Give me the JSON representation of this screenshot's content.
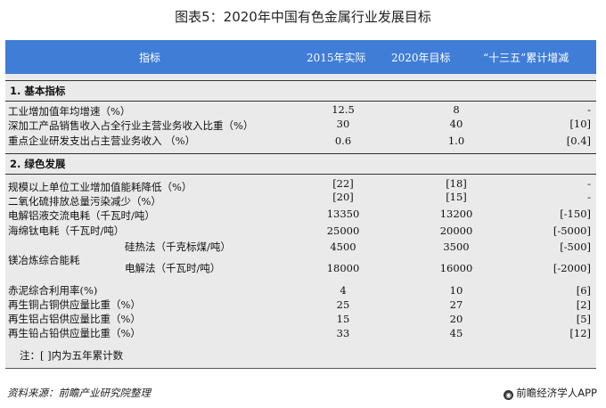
{
  "title": "图表5：2020年中国有色金属行业发展目标",
  "header": {
    "indicator": "指标",
    "y2015": "2015年实际",
    "y2020": "2020年目标",
    "cumulative": "“十三五”累计增减"
  },
  "sections": [
    {
      "label": "1. 基本指标",
      "rows": [
        {
          "name": "工业增加值年均增速（%）",
          "y2015": "12.5",
          "y2020": "8",
          "cum": "-"
        },
        {
          "name": "深加工产品销售收入占全行业主营业务收入比重（%）",
          "y2015": "30",
          "y2020": "40",
          "cum": "[10]"
        },
        {
          "name": "重点企业研发支出占主营业务收入  （%）",
          "y2015": "0.6",
          "y2020": "1.0",
          "cum": "[0.4]"
        }
      ]
    },
    {
      "label": "2. 绿色发展",
      "rows": [
        {
          "name": "规模以上单位工业增加值能耗降低（%）",
          "y2015": "[22]",
          "y2020": "[18]",
          "cum": "-"
        },
        {
          "name": "二氧化硫排放总量污染减少（%）",
          "y2015": "[20]",
          "y2020": "[15]",
          "cum": "-"
        },
        {
          "name": "电解铝液交流电耗（千瓦时/吨）",
          "y2015": "13350",
          "y2020": "13200",
          "cum": "[-150]"
        },
        {
          "name": "海绵钛电耗（千瓦时/吨）",
          "y2015": "25000",
          "y2020": "20000",
          "cum": "[-5000]"
        }
      ],
      "magnesium": {
        "name": "镁冶炼综合能耗",
        "sub": [
          {
            "name": "硅热法（千克标煤/吨）",
            "y2015": "4500",
            "y2020": "3500",
            "cum": "[-500]"
          },
          {
            "name": "电解法（千瓦时/吨）",
            "y2015": "18000",
            "y2020": "16000",
            "cum": "[-2000]"
          }
        ]
      },
      "rows_after": [
        {
          "name": "赤泥综合利用率(%)",
          "y2015": "4",
          "y2020": "10",
          "cum": "[6]"
        },
        {
          "name": "再生铜占铜供应量比重（%）",
          "y2015": "25",
          "y2020": "27",
          "cum": "[2]"
        },
        {
          "name": "再生铝占铝供应量比重（%）",
          "y2015": "15",
          "y2020": "20",
          "cum": "[5]"
        },
        {
          "name": "再生铅占铅供应量比重（%）",
          "y2015": "33",
          "y2020": "45",
          "cum": "[12]"
        }
      ]
    }
  ],
  "note": "注：[  ]内为五年累计数",
  "source": "资料来源：前瞻产业研究院整理",
  "brand": "前瞻经济学人APP",
  "colors": {
    "header_bg": "#3f7dd6",
    "table_bg": "#eaeaea"
  }
}
